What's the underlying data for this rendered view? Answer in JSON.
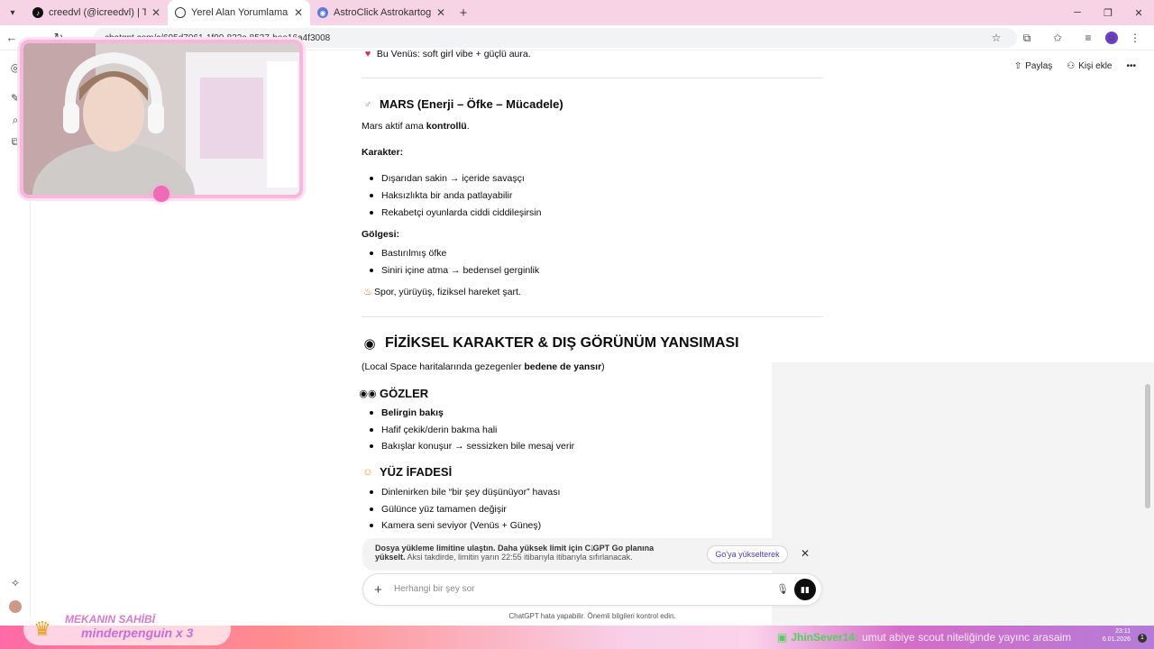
{
  "browser": {
    "tabs": [
      {
        "title": "creedvl (@icreedvl) | TikTok",
        "icon": "tiktok-icon",
        "active": false
      },
      {
        "title": "Yerel Alan Yorumlaması",
        "icon": "chatgpt-icon",
        "active": true
      },
      {
        "title": "AstroClick Astrokartografi Yoru",
        "icon": "globe-icon",
        "active": false
      }
    ],
    "url": "chatgpt.com/c/695d7061-1f90-832c-8537-bee16a4f3008"
  },
  "header_actions": {
    "share": "Paylaş",
    "add_person": "Kişi ekle"
  },
  "content": {
    "venus_line": "Bu Venüs: soft girl vibe + güçlü aura.",
    "mars": {
      "heading": "MARS (Enerji – Öfke – Mücadele)",
      "intro_pre": "Mars aktif ama ",
      "intro_bold": "kontrollü",
      "intro_post": ".",
      "char_label": "Karakter:",
      "char_items": [
        "Dışarıdan sakin → içeride savaşçı",
        "Haksızlıkta bir anda patlayabilir",
        "Rekabetçi oyunlarda ciddi ciddileşirsin"
      ],
      "shadow_label": "Gölgesi:",
      "shadow_items": [
        "Bastırılmış öfke",
        "Siniri içine atma → bedensel gerginlik"
      ],
      "tip": "Spor, yürüyüş, fiziksel hareket şart."
    },
    "physical": {
      "heading": "FİZİKSEL KARAKTER & DIŞ GÖRÜNÜM YANSIMASI",
      "note_pre": "(Local Space haritalarında gezegenler ",
      "note_bold": "bedene de yansır",
      "note_post": ")",
      "eyes_heading": "GÖZLER",
      "eyes_items": [
        "Belirgin bakış",
        "Hafif çekik/derin bakma hali",
        "Bakışlar konuşur → sessizken bile mesaj verir"
      ],
      "face_heading": "YÜZ İFADESİ",
      "face_items": [
        "Dinlenirken bile “bir şey düşünüyor” havası",
        "Gülünce yüz tamamen değişir",
        "Kamera seni seviyor (Venüs + Güneş)"
      ]
    }
  },
  "notice": {
    "line1": "Dosya yükleme limitine ulaştın. Daha yüksek limit için C  GPT Go planına",
    "line2_bold": "yükselt.",
    "line2_rest": " Aksi takdirde, limitin yarın 22:55 itibarıyla itibarıyla sıfırlanacak.",
    "button": "Go'ya yükselterek"
  },
  "composer": {
    "placeholder": "Herhangi bir şey sor"
  },
  "disclaimer": "ChatGPT hata yapabilir. Önemli bilgileri kontrol edin.",
  "stream": {
    "host_title": "MEKANIN SAHİBİ",
    "host_name": "minderpenguin x 3",
    "chat_user": "JhinSever14:",
    "chat_message": "umut abiye scout niteliğinde yayınc arasaim",
    "tray_time": "23:11",
    "tray_date": "6.01.2026",
    "notif_count": "1"
  },
  "colors": {
    "tab_strip": "#f6d4e6",
    "cam_border": "#f7b6da",
    "accent_violet": "#4a3bc4"
  }
}
